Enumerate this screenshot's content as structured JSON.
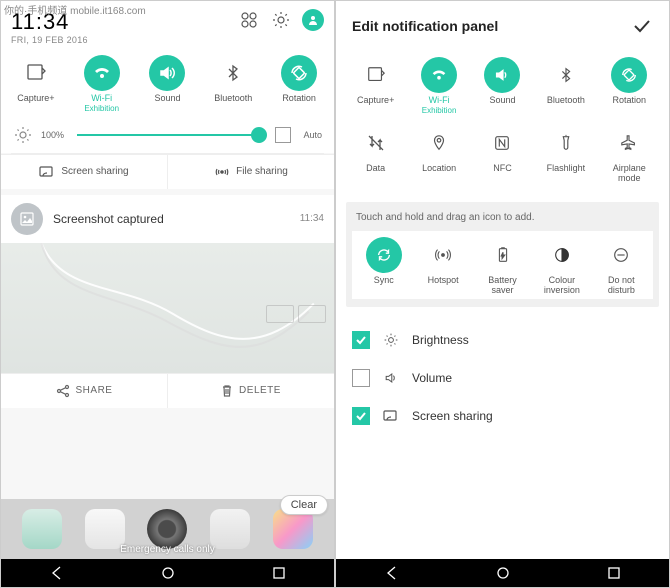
{
  "watermark": "你的·手机频道 mobile.it168.com",
  "left": {
    "time": "11:34",
    "date": "FRI, 19 FEB 2016",
    "qs": [
      {
        "label": "Capture+",
        "on": false
      },
      {
        "label": "Wi-Fi",
        "sub": "Exhibition",
        "on": true
      },
      {
        "label": "Sound",
        "on": true
      },
      {
        "label": "Bluetooth",
        "on": false
      },
      {
        "label": "Rotation",
        "on": true
      }
    ],
    "brightness_pct": "100%",
    "auto": "Auto",
    "screen_sharing": "Screen sharing",
    "file_sharing": "File sharing",
    "notif_title": "Screenshot captured",
    "notif_time": "11:34",
    "share": "SHARE",
    "delete": "DELETE",
    "clear": "Clear",
    "emergency": "Emergency calls only"
  },
  "right": {
    "title": "Edit notification panel",
    "row1": [
      {
        "label": "Capture+",
        "on": false
      },
      {
        "label": "Wi-Fi",
        "sub": "Exhibition",
        "on": true
      },
      {
        "label": "Sound",
        "on": true
      },
      {
        "label": "Bluetooth",
        "on": false
      },
      {
        "label": "Rotation",
        "on": true
      }
    ],
    "row2": [
      {
        "label": "Data"
      },
      {
        "label": "Location"
      },
      {
        "label": "NFC"
      },
      {
        "label": "Flashlight"
      },
      {
        "label": "Airplane\nmode"
      }
    ],
    "drag_hint": "Touch and hold and drag an icon to add.",
    "drag_items": [
      {
        "label": "Sync",
        "on": true
      },
      {
        "label": "Hotspot"
      },
      {
        "label": "Battery\nsaver"
      },
      {
        "label": "Colour\ninversion"
      },
      {
        "label": "Do not\ndisturb"
      }
    ],
    "checks": [
      {
        "label": "Brightness",
        "checked": true,
        "icon": "sun"
      },
      {
        "label": "Volume",
        "checked": false,
        "icon": "sound"
      },
      {
        "label": "Screen sharing",
        "checked": true,
        "icon": "cast"
      }
    ]
  },
  "colors": {
    "accent": "#24c7a6"
  }
}
